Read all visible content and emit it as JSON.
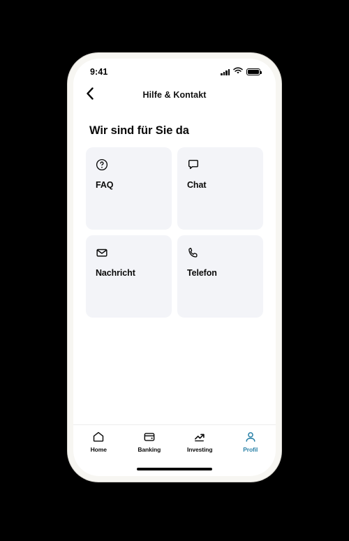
{
  "status_bar": {
    "time": "9:41",
    "signal_icon": "signal-bars-icon",
    "wifi_icon": "wifi-icon",
    "battery_icon": "battery-icon"
  },
  "nav": {
    "back_icon": "chevron-left-icon",
    "title": "Hilfe & Kontakt"
  },
  "main": {
    "heading": "Wir sind für Sie da",
    "cards": [
      {
        "label": "FAQ",
        "icon": "question-circle-icon"
      },
      {
        "label": "Chat",
        "icon": "chat-bubble-icon"
      },
      {
        "label": "Nachricht",
        "icon": "envelope-icon"
      },
      {
        "label": "Telefon",
        "icon": "phone-icon"
      }
    ]
  },
  "tab_bar": {
    "items": [
      {
        "label": "Home",
        "icon": "home-icon",
        "active": false
      },
      {
        "label": "Banking",
        "icon": "wallet-icon",
        "active": false
      },
      {
        "label": "Investing",
        "icon": "trending-up-icon",
        "active": false
      },
      {
        "label": "Profil",
        "icon": "person-icon",
        "active": true
      }
    ],
    "active_color": "#2b82a8",
    "inactive_color": "#0a0a0a"
  },
  "colors": {
    "background": "#000000",
    "phone_bezel": "#f7f6f2",
    "screen": "#ffffff",
    "card_background": "#f3f4f8",
    "text": "#0a0a0a",
    "accent": "#2b82a8"
  }
}
